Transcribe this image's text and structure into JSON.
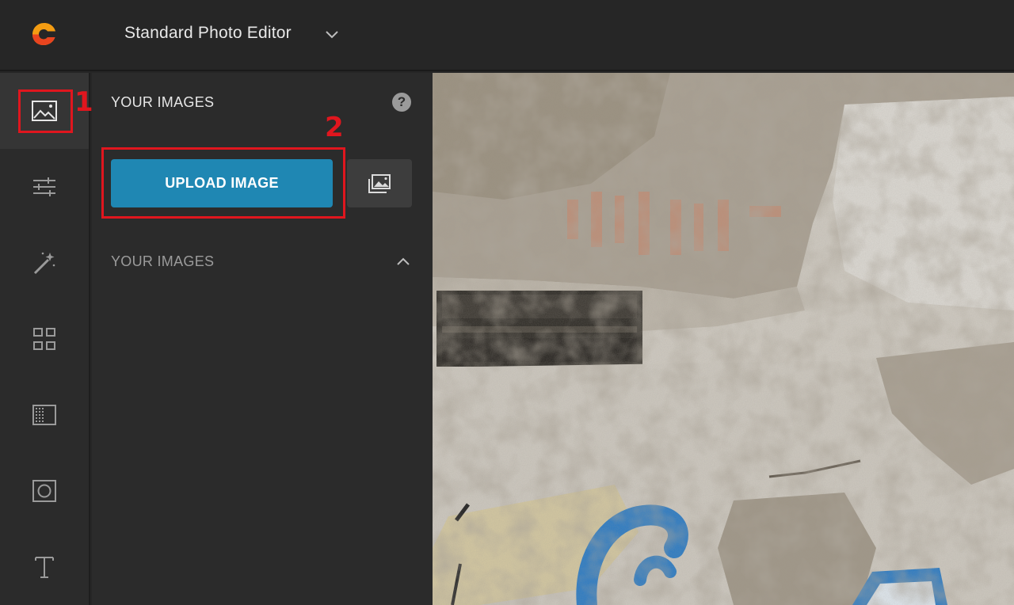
{
  "header": {
    "title": "Standard Photo Editor",
    "brand_color": "#f39c12"
  },
  "rail": {
    "items": [
      {
        "icon": "image-icon",
        "active": true
      },
      {
        "icon": "sliders-icon",
        "active": false
      },
      {
        "icon": "magic-wand-icon",
        "active": false
      },
      {
        "icon": "grid-icon",
        "active": false
      },
      {
        "icon": "texture-icon",
        "active": false
      },
      {
        "icon": "vignette-icon",
        "active": false
      },
      {
        "icon": "text-icon",
        "active": false
      }
    ]
  },
  "panel": {
    "title": "YOUR IMAGES",
    "help_label": "?",
    "upload_label": "UPLOAD IMAGE",
    "section_label": "YOUR IMAGES"
  },
  "annotations": {
    "one": "1",
    "two": "2",
    "color": "#e0161e"
  },
  "colors": {
    "accent": "#1f87b3",
    "background": "#262626",
    "panel": "#2b2b2b"
  }
}
